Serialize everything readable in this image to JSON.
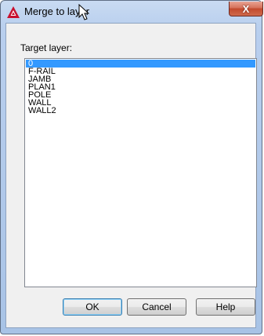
{
  "window": {
    "title": "Merge to layer",
    "close_label": "X"
  },
  "target_label": "Target layer:",
  "layers": [
    "0",
    "F-RAIL",
    "JAMB",
    "PLAN1",
    "POLE",
    "WALL",
    "WALL2"
  ],
  "selected_index": 0,
  "buttons": {
    "ok": "OK",
    "cancel": "Cancel",
    "help": "Help"
  },
  "colors": {
    "selection": "#3399ff",
    "close": "#c94a2d",
    "app_icon": "#c8102e"
  },
  "icons": {
    "app": "autocad-logo-icon",
    "close": "close-icon",
    "cursor": "mouse-pointer-icon"
  }
}
